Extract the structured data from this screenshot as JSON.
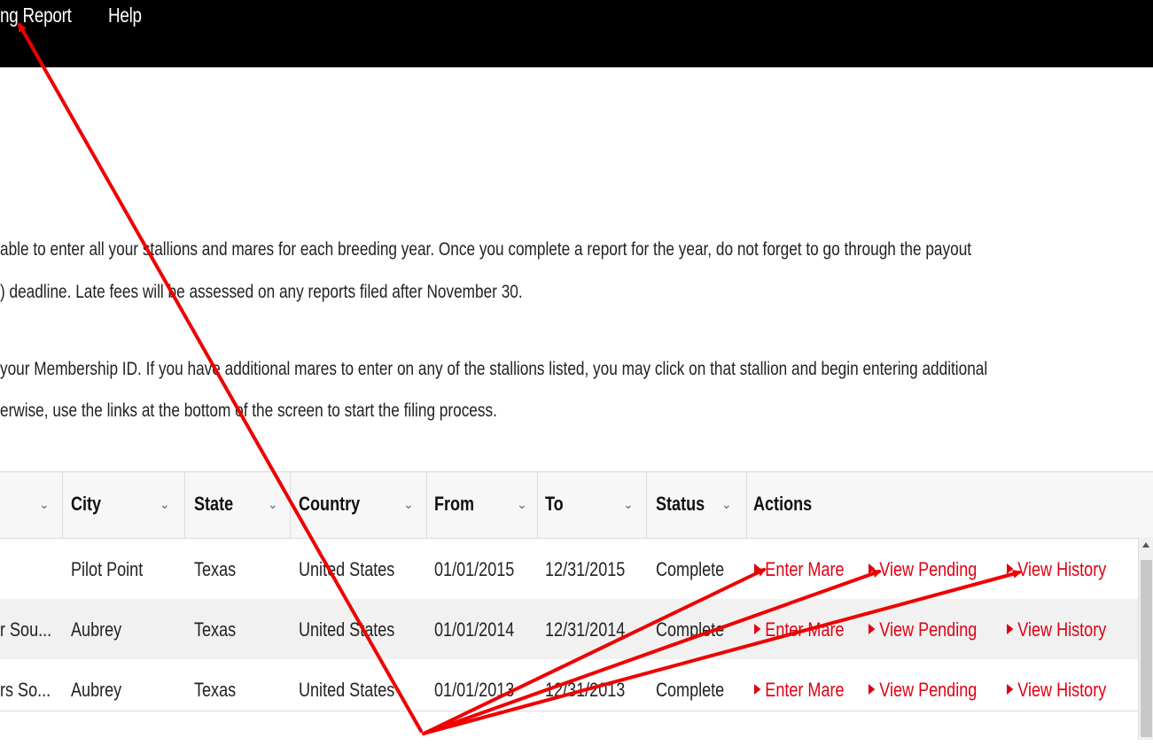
{
  "nav": {
    "items": [
      {
        "label": "ng Report"
      },
      {
        "label": "Help"
      }
    ]
  },
  "intro": {
    "line1": "able to enter all your stallions and mares for each breeding year. Once you complete a report for the year, do not forget to go through the payout",
    "line2": ") deadline. Late fees will be assessed on any reports filed after November 30.",
    "line3": "your Membership ID. If you have additional mares to enter on any of the stallions listed, you may click on that stallion and begin entering additional",
    "line4": "erwise, use the links at the bottom of the screen to start the filing process."
  },
  "table": {
    "headers": [
      "",
      "City",
      "State",
      "Country",
      "From",
      "To",
      "Status",
      "Actions"
    ],
    "rows": [
      {
        "name": "",
        "city": "Pilot Point",
        "state": "Texas",
        "country": "United States",
        "from": "01/01/2015",
        "to": "12/31/2015",
        "status": "Complete"
      },
      {
        "name": "r Sou...",
        "city": "Aubrey",
        "state": "Texas",
        "country": "United States",
        "from": "01/01/2014",
        "to": "12/31/2014",
        "status": "Complete"
      },
      {
        "name": "rs So...",
        "city": "Aubrey",
        "state": "Texas",
        "country": "United States",
        "from": "01/01/2013",
        "to": "12/31/2013",
        "status": "Complete"
      }
    ],
    "actions": {
      "enter_mare": "Enter Mare",
      "view_pending": "View Pending",
      "view_history": "View History"
    }
  },
  "bottom_fragment": "",
  "colors": {
    "topbar": "#000000",
    "action_link": "#e00012",
    "annotation_arrow": "#ee0000",
    "row_alt": "#f1f1f1"
  }
}
